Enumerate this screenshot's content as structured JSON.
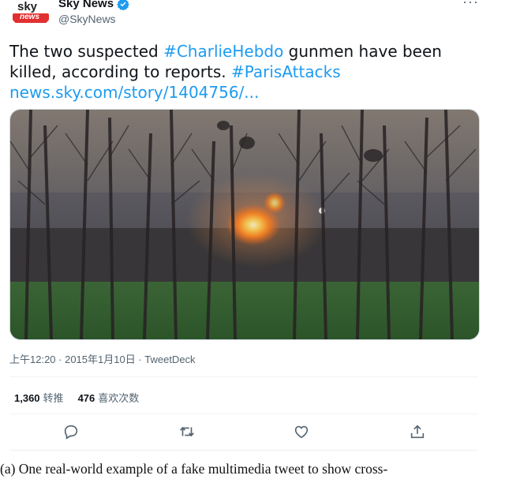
{
  "tweet": {
    "display_name": "Sky News",
    "handle": "@SkyNews",
    "more_glyph": "···",
    "avatar_logo_top": "sky",
    "avatar_logo_bottom": "news",
    "text": {
      "part1": "The two suspected ",
      "hashtag1": "#CharlieHebdo",
      "part2": " gunmen have been killed, according to reports. ",
      "hashtag2": "#ParisAttacks",
      "link": "news.sky.com/story/1404756/..."
    },
    "timestamp": "上午12:20 · 2015年1月10日 · TweetDeck",
    "stats": {
      "retweets_count": "1,360",
      "retweets_label": "转推",
      "likes_count": "476",
      "likes_label": "喜欢次数"
    },
    "actions": [
      "reply-icon",
      "retweet-icon",
      "like-icon",
      "share-icon"
    ]
  },
  "caption": "(a) One real-world example of a fake multimedia tweet to show cross-",
  "colors": {
    "link": "#1d9bf0",
    "verified": "#1d9bf0",
    "muted": "#536471"
  }
}
